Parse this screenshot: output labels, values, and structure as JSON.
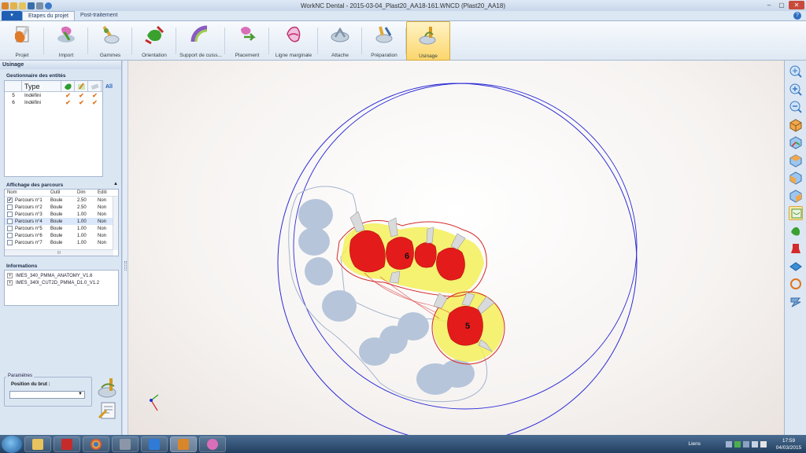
{
  "window": {
    "title": "WorkNC Dental - 2015-03-04_Plast20_AA18-161.WNCD (Plast20_AA18)",
    "menu_button": "▾"
  },
  "tabs": [
    {
      "label": "Etapes du projet",
      "active": true
    },
    {
      "label": "Post-traitement",
      "active": false
    }
  ],
  "ribbon": [
    {
      "label": "Projet",
      "icon": "project-icon"
    },
    {
      "label": "Import",
      "icon": "import-icon"
    },
    {
      "label": "Gammes",
      "icon": "gammes-icon"
    },
    {
      "label": "Orientation",
      "icon": "orientation-icon"
    },
    {
      "label": "Support de cuiss...",
      "icon": "support-icon"
    },
    {
      "label": "Placement",
      "icon": "placement-icon"
    },
    {
      "label": "Ligne marginale",
      "icon": "margin-line-icon"
    },
    {
      "label": "Attache",
      "icon": "attache-icon"
    },
    {
      "label": "Préparation",
      "icon": "preparation-icon"
    },
    {
      "label": "Usinage",
      "icon": "usinage-icon",
      "active": true
    }
  ],
  "panel": {
    "title": "Usinage",
    "entities": {
      "title": "Gestionnaire des entités",
      "column_type": "Type",
      "all_label": "All",
      "rows": [
        {
          "id": "5",
          "type": "Indéfini"
        },
        {
          "id": "6",
          "type": "Indéfini"
        }
      ]
    },
    "toolpaths": {
      "title": "Affichage des parcours",
      "columns": [
        "Nom",
        "Outil",
        "Dim",
        "Editi"
      ],
      "rows": [
        {
          "name": "Parcours n°1",
          "tool": "Boule",
          "dim": "2.50",
          "edit": "Non",
          "checked": true
        },
        {
          "name": "Parcours n°2",
          "tool": "Boule",
          "dim": "2.50",
          "edit": "Non",
          "checked": false
        },
        {
          "name": "Parcours n°3",
          "tool": "Boule",
          "dim": "1.00",
          "edit": "Non",
          "checked": false
        },
        {
          "name": "Parcours n°4",
          "tool": "Boule",
          "dim": "1.00",
          "edit": "Non",
          "checked": false,
          "selected": true
        },
        {
          "name": "Parcours n°5",
          "tool": "Boule",
          "dim": "1.00",
          "edit": "Non",
          "checked": false
        },
        {
          "name": "Parcours n°6",
          "tool": "Boule",
          "dim": "1.00",
          "edit": "Non",
          "checked": false
        },
        {
          "name": "Parcours n°7",
          "tool": "Boule",
          "dim": "1.00",
          "edit": "Non",
          "checked": false
        }
      ],
      "scroll_marker": "III"
    },
    "informations": {
      "title": "Informations",
      "items": [
        "IMES_340_PMMA_ANATOMY_V1.6",
        "IMES_340I_CUT2D_PMMA_D1.0_V1.2"
      ]
    },
    "params": {
      "title": "Paramètres",
      "label": "Position du brut :",
      "value": ""
    }
  },
  "viewport": {
    "labels": [
      "6",
      "5"
    ]
  },
  "taskbar": {
    "tray_text": "Liens",
    "time": "17:59",
    "date": "04/03/2015"
  }
}
